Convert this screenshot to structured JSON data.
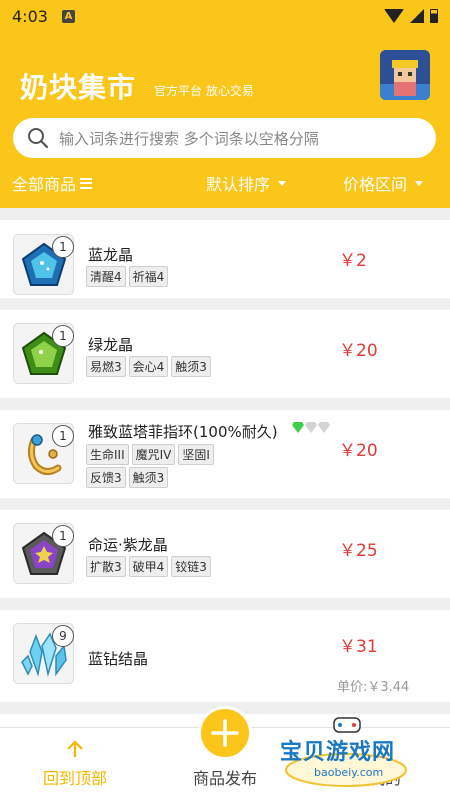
{
  "status": {
    "time": "4:03",
    "indicator": "A"
  },
  "header": {
    "title": "奶块集市",
    "subtitle": "官方平台 放心交易",
    "search_placeholder": "输入词条进行搜索 多个词条以空格分隔"
  },
  "filters": {
    "all": "全部商品",
    "sort": "默认排序",
    "price": "价格区间"
  },
  "items": [
    {
      "qty": "1",
      "name": "蓝龙晶",
      "tags": [
        "清醒4",
        "祈福4"
      ],
      "price": "￥2",
      "icon": "blue-dragon-crystal-icon",
      "color": "#2a8fd6"
    },
    {
      "qty": "1",
      "name": "绿龙晶",
      "tags": [
        "易燃3",
        "会心4",
        "触须3"
      ],
      "price": "￥20",
      "icon": "green-dragon-crystal-icon",
      "color": "#58a924"
    },
    {
      "qty": "1",
      "name": "雅致蓝塔菲指环(100%耐久)",
      "tags": [
        "生命III",
        "魔咒IV",
        "坚固I"
      ],
      "tags2": [
        "反馈3",
        "触须3"
      ],
      "price": "￥20",
      "icon": "ring-icon",
      "color": "#d8a437"
    },
    {
      "qty": "1",
      "name": "命运·紫龙晶",
      "tags": [
        "扩散3",
        "破甲4",
        "铰链3"
      ],
      "price": "￥25",
      "icon": "purple-dragon-crystal-icon",
      "color": "#7d3fb0"
    },
    {
      "qty": "9",
      "name": "蓝钻结晶",
      "tags": [],
      "price": "￥31",
      "unit_price": "单价:￥3.44",
      "icon": "blue-diamond-crystal-icon",
      "color": "#4fb6e0"
    }
  ],
  "bottom_nav": {
    "top": "回到顶部",
    "publish": "商品发布",
    "mine": "我的"
  },
  "watermark": {
    "title": "宝贝游戏网",
    "url": "baobeiy.com"
  },
  "colors": {
    "brand": "#fbc61a",
    "price": "#e53935"
  }
}
